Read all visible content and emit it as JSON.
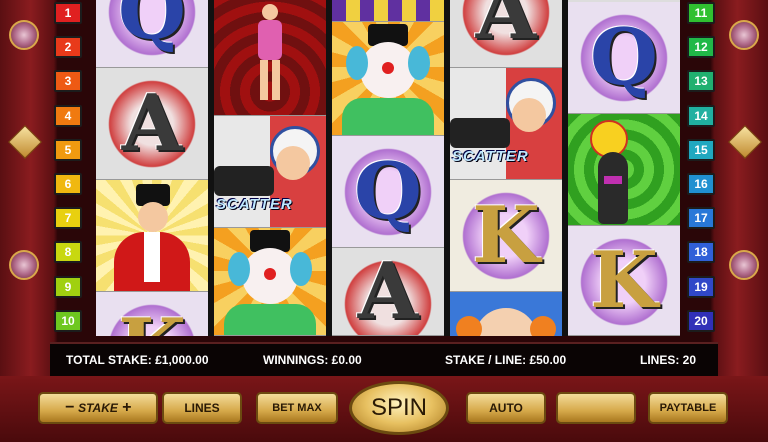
{
  "paylines": {
    "left": [
      "1",
      "2",
      "3",
      "4",
      "5",
      "6",
      "7",
      "8",
      "9",
      "10"
    ],
    "right": [
      "11",
      "12",
      "13",
      "14",
      "15",
      "16",
      "17",
      "18",
      "19",
      "20"
    ],
    "colors": [
      "#e02020",
      "#e83a1a",
      "#ee5a14",
      "#f07a10",
      "#f09a10",
      "#f0b810",
      "#e8d010",
      "#c8d810",
      "#a0d010",
      "#6ec820",
      "#30c030",
      "#20b848",
      "#20b070",
      "#20b0a0",
      "#20a8c0",
      "#2090d0",
      "#2878d8",
      "#3060d8",
      "#3048c8",
      "#3030b8"
    ]
  },
  "reels": [
    [
      "Q",
      "A",
      "ringmaster",
      "K"
    ],
    [
      "strongwoman",
      "scatter-cannon",
      "clown",
      ""
    ],
    [
      "tent",
      "clown",
      "Q",
      "A"
    ],
    [
      "A",
      "scatter-cannon",
      "K",
      "bald-clown"
    ],
    [
      "Q",
      "seal",
      "K",
      ""
    ]
  ],
  "symbols": {
    "scatter_label": "SCATTER"
  },
  "info": {
    "total_stake": "TOTAL STAKE: £1,000.00",
    "winnings": "WINNINGS:  £0.00",
    "stake_line": "STAKE / LINE: £50.00",
    "lines": "LINES: 20"
  },
  "controls": {
    "stake_minus": "−",
    "stake_label": "STAKE",
    "stake_plus": "+",
    "lines": "LINES",
    "bet_max": "BET MAX",
    "spin": "SPIN",
    "auto": "AUTO",
    "blank": "",
    "paytable": "PAYTABLE"
  },
  "colors": {
    "frame": "#8a1c1f",
    "button_gold": "#d6a94a"
  }
}
